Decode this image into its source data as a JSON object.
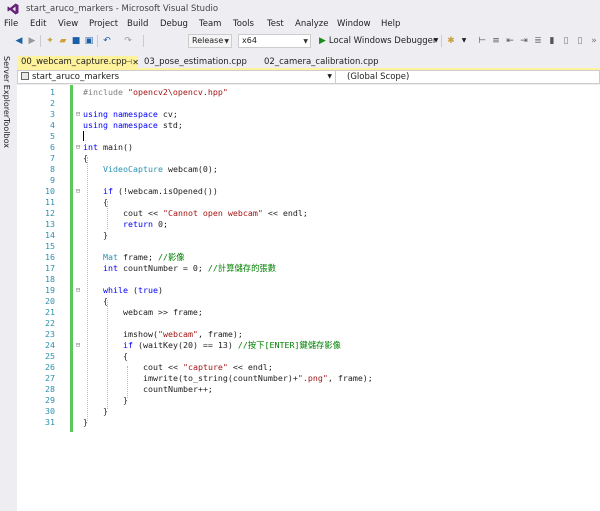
{
  "window": {
    "title": "start_aruco_markers - Microsoft Visual Studio"
  },
  "menu": [
    "File",
    "Edit",
    "View",
    "Project",
    "Build",
    "Debug",
    "Team",
    "Tools",
    "Test",
    "Analyze",
    "Window",
    "Help"
  ],
  "toolbar": {
    "configuration": "Release",
    "platform": "x64",
    "debugger_label": "Local Windows Debugger"
  },
  "sidebar": {
    "server_explorer": "Server Explorer",
    "toolbox": "Toolbox"
  },
  "tabs": [
    {
      "label": "00_webcam_capture.cpp",
      "active": true
    },
    {
      "label": "03_pose_estimation.cpp",
      "active": false
    },
    {
      "label": "02_camera_calibration.cpp",
      "active": false
    }
  ],
  "navbar": {
    "project": "start_aruco_markers",
    "scope": "(Global Scope)"
  },
  "code": {
    "line_numbers": [
      "1",
      "2",
      "3",
      "4",
      "5",
      "6",
      "7",
      "8",
      "9",
      "10",
      "11",
      "12",
      "13",
      "14",
      "15",
      "16",
      "17",
      "18",
      "19",
      "20",
      "21",
      "22",
      "23",
      "24",
      "25",
      "26",
      "27",
      "28",
      "29",
      "30",
      "31"
    ],
    "l1_pp": "#include",
    "l1_str": "\"opencv2\\opencv.hpp\"",
    "l3_kw": "using namespace",
    "l3_rest": " cv;",
    "l4_kw": "using namespace",
    "l4_rest": " std;",
    "l6_kw": "int",
    "l6_rest": " main()",
    "l7": "{",
    "l8_ty": "VideoCapture",
    "l8_rest": " webcam(0);",
    "l10_kw": "if",
    "l10_rest": " (!webcam.isOpened())",
    "l11": "{",
    "l12_a": "cout << ",
    "l12_str": "\"Cannot open webcam\"",
    "l12_b": " << endl;",
    "l13_kw": "return",
    "l13_rest": " 0;",
    "l14": "}",
    "l16_ty": "Mat",
    "l16_rest": " frame; ",
    "l16_cm": "//影像",
    "l17_kw": "int",
    "l17_rest": " countNumber = 0; ",
    "l17_cm": "//計算儲存的張數",
    "l19_kw": "while",
    "l19_a": " (",
    "l19_kw2": "true",
    "l19_b": ")",
    "l20": "{",
    "l21": "webcam >> frame;",
    "l23_a": "imshow(",
    "l23_str": "\"webcam\"",
    "l23_b": ", frame);",
    "l24_kw": "if",
    "l24_rest": " (waitKey(20) == 13) ",
    "l24_cm": "//按下[ENTER]鍵儲存影像",
    "l25": "{",
    "l26_a": "cout << ",
    "l26_str": "\"capture\"",
    "l26_b": " << endl;",
    "l27_a": "imwrite(to_string(countNumber)+",
    "l27_str": "\".png\"",
    "l27_b": ", frame);",
    "l28": "countNumber++;",
    "l29": "}",
    "l30": "}",
    "l31": "}"
  },
  "colors": {
    "keyword": "#0000ff",
    "type": "#2b91af",
    "string": "#a31515",
    "comment": "#008000",
    "active_tab": "#fff29d",
    "change_bar": "#59c95c"
  }
}
